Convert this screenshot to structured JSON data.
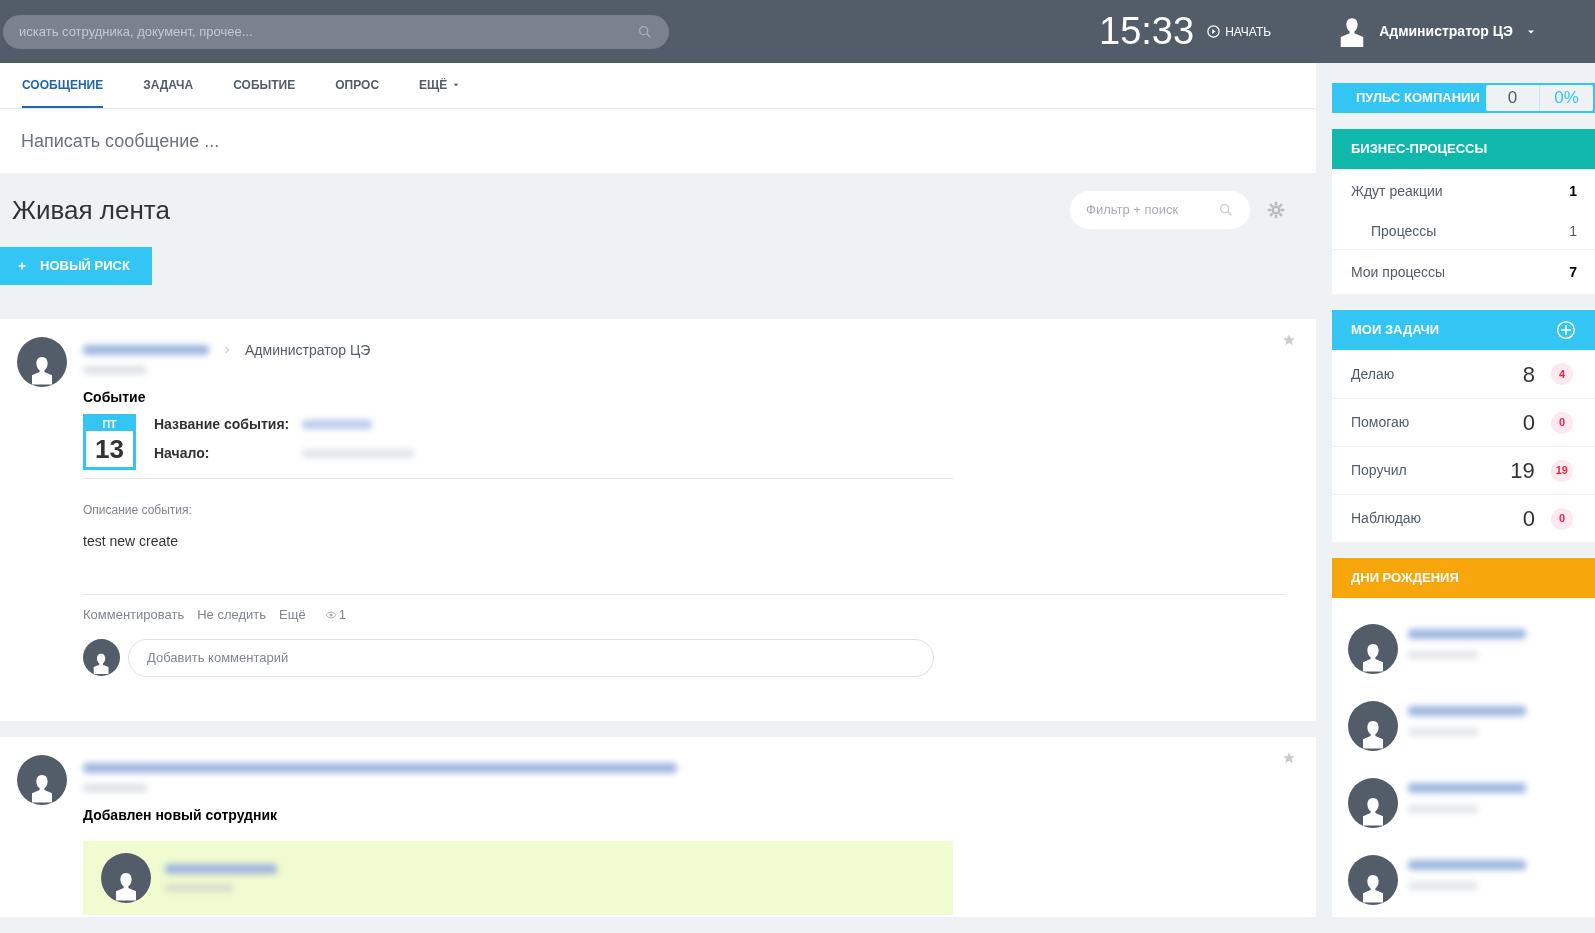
{
  "header": {
    "search_placeholder": "искать сотрудника, документ, прочее...",
    "time": "15:33",
    "start_label": "НАЧАТЬ",
    "user_name": "Администратор ЦЭ"
  },
  "composer": {
    "tabs": [
      {
        "label": "СООБЩЕНИЕ",
        "selected": true,
        "kind": "tab"
      },
      {
        "label": "ЗАДАЧА",
        "selected": false,
        "kind": "tab"
      },
      {
        "label": "СОБЫТИЕ",
        "selected": false,
        "kind": "tab"
      },
      {
        "label": "ОПРОС",
        "selected": false,
        "kind": "tab"
      },
      {
        "label": "ЕЩЁ",
        "selected": false,
        "kind": "dropdown"
      }
    ],
    "placeholder": "Написать сообщение ..."
  },
  "feed": {
    "title": "Живая лента",
    "filter_placeholder": "Фильтр + поиск",
    "new_button": "НОВЫЙ РИСК"
  },
  "posts": [
    {
      "kind": "event",
      "author_blurred": true,
      "target": "Администратор ЦЭ",
      "type_label": "Событие",
      "calendar": {
        "weekday": "ПТ",
        "day": "13"
      },
      "fields": [
        "Название события:",
        "Начало:"
      ],
      "description_label": "Описание события:",
      "description": "test new create",
      "actions": [
        "Комментировать",
        "Не следить",
        "Ещё"
      ],
      "views": "1",
      "comment_placeholder": "Добавить комментарий"
    },
    {
      "kind": "new_employee",
      "author_blurred": true,
      "type_label": "Добавлен новый сотрудник"
    }
  ],
  "sidebar": {
    "pulse": {
      "title": "ПУЛЬС КОМПАНИИ",
      "count": "0",
      "percent": "0%"
    },
    "business_processes": {
      "title": "БИЗНЕС-ПРОЦЕССЫ",
      "rows": [
        {
          "label": "Ждут реакции",
          "count": "1",
          "children": [
            {
              "label": "Процессы",
              "count": "1"
            }
          ]
        },
        {
          "label": "Мои процессы",
          "count": "7"
        }
      ]
    },
    "tasks": {
      "title": "МОИ ЗАДАЧИ",
      "rows": [
        {
          "label": "Делаю",
          "count": "8",
          "counter": "4"
        },
        {
          "label": "Помогаю",
          "count": "0",
          "counter": "0"
        },
        {
          "label": "Поручил",
          "count": "19",
          "counter": "19"
        },
        {
          "label": "Наблюдаю",
          "count": "0",
          "counter": "0"
        }
      ]
    },
    "birthdays": {
      "title": "ДНИ РОЖДЕНИЯ",
      "people": [
        {
          "blurred": true
        },
        {
          "blurred": true
        },
        {
          "blurred": true
        },
        {
          "blurred": true
        }
      ]
    }
  }
}
